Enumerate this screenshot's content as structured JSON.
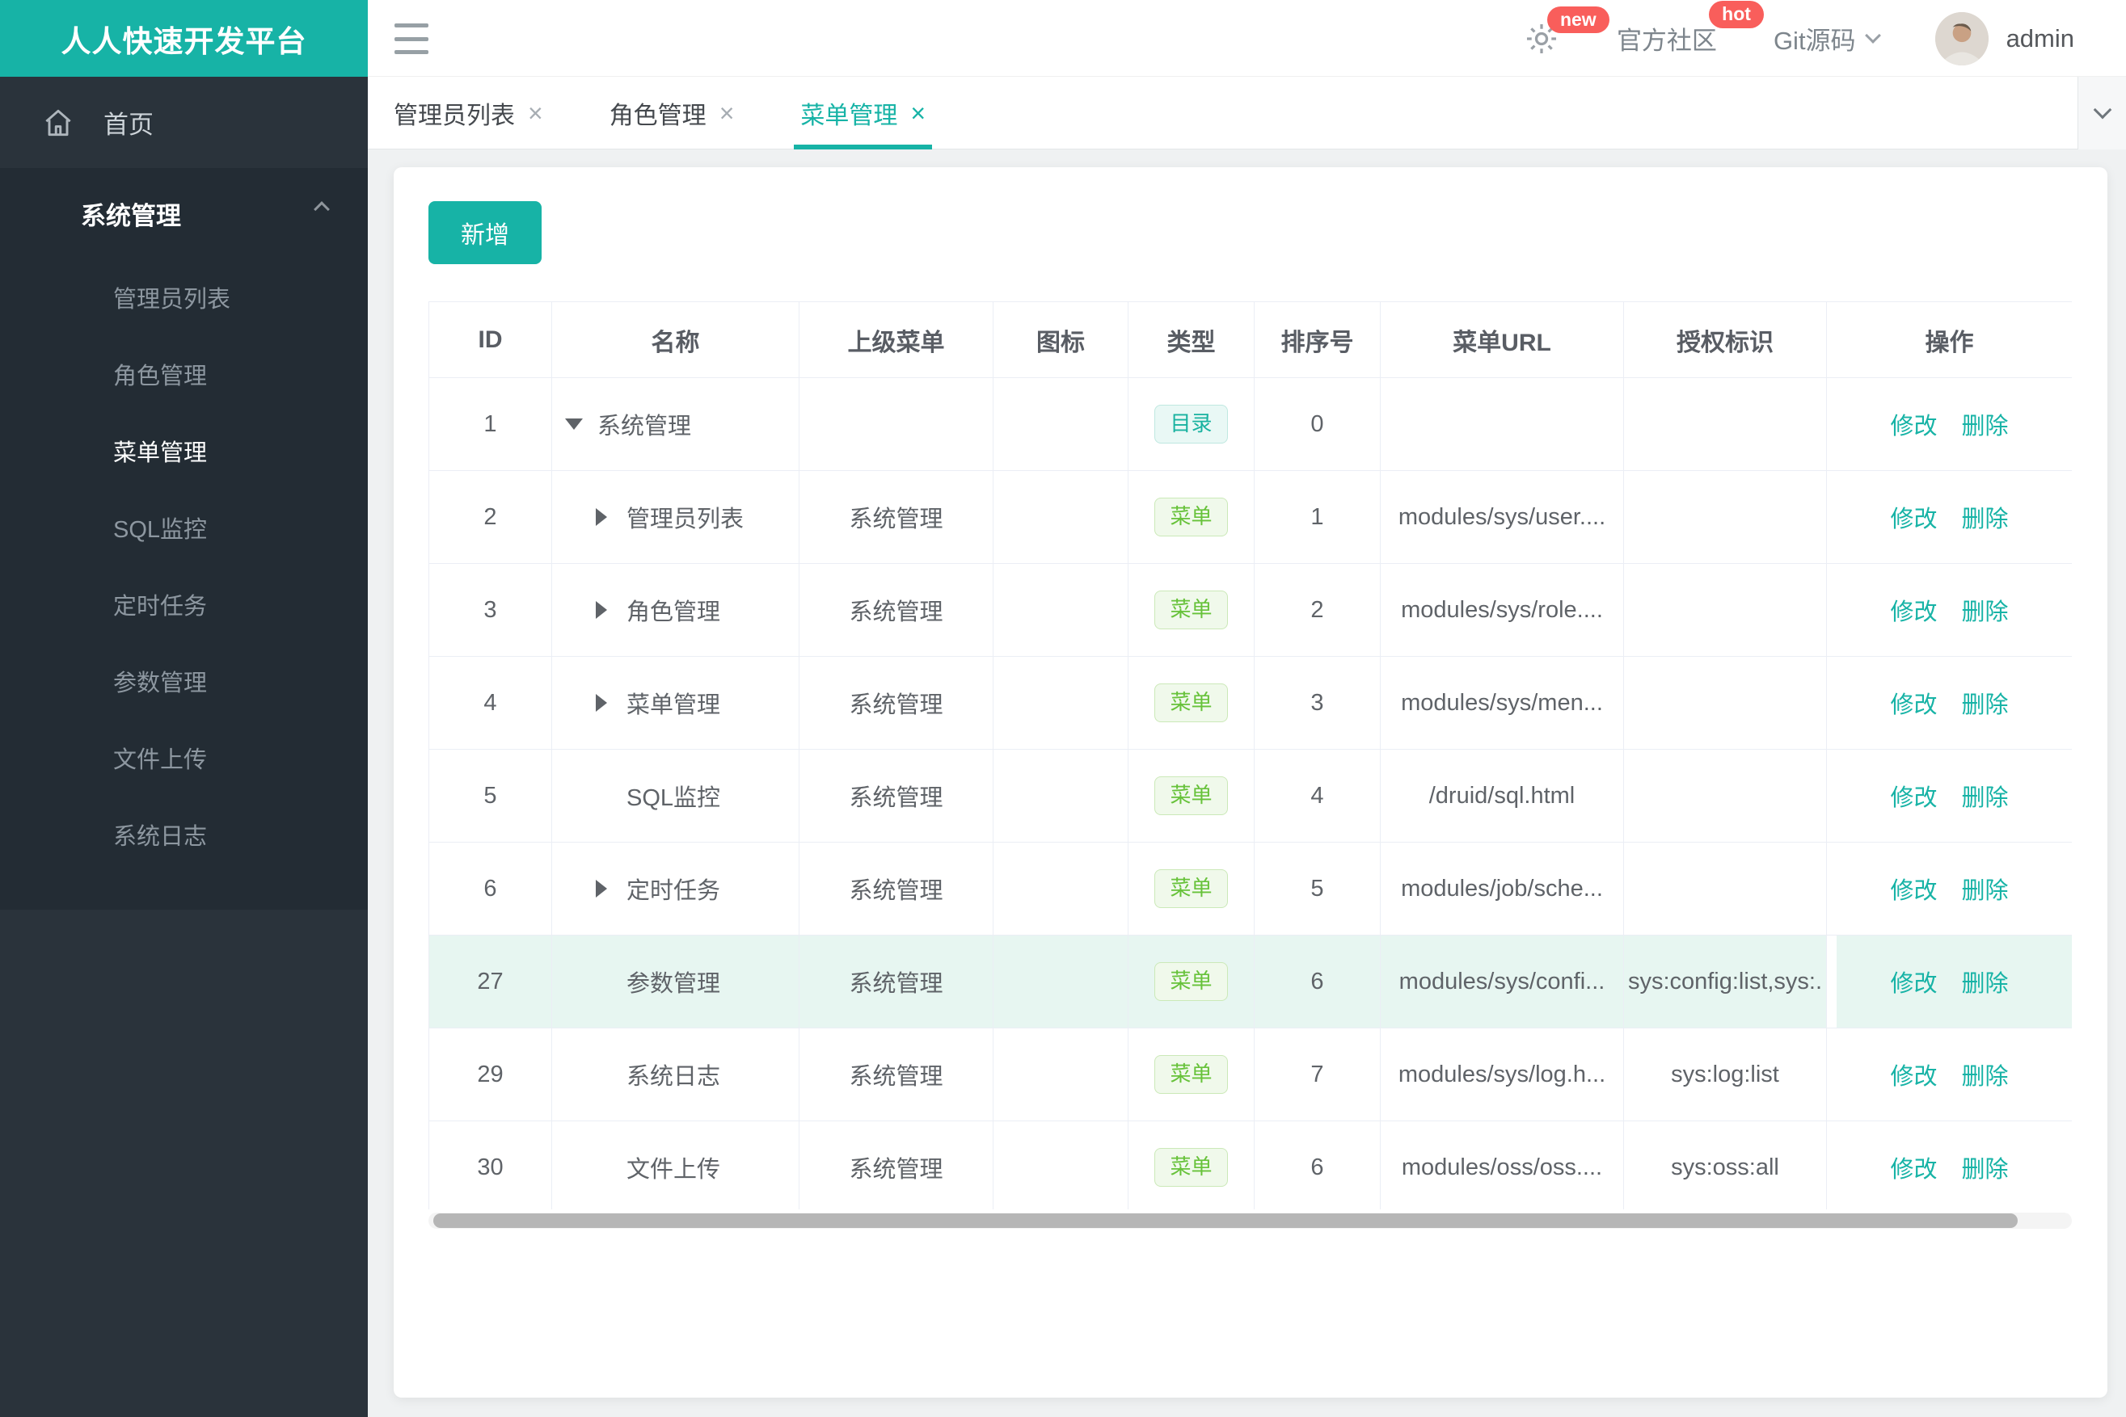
{
  "app": {
    "title": "人人快速开发平台"
  },
  "theme": {
    "accent": "#17b3a6",
    "badge_red": "#f95e5b",
    "sidebar_bg": "#2a333b",
    "sidebar_group_bg": "#232c34",
    "highlight_row_bg": "#e7f6f1",
    "dir_tag_color": "#19b2a0",
    "menu_tag_color": "#67c23a"
  },
  "header": {
    "gear_badge": "new",
    "community_label": "官方社区",
    "community_badge": "hot",
    "git_label": "Git源码",
    "user": "admin"
  },
  "sidebar": {
    "home_label": "首页",
    "group": {
      "label": "系统管理",
      "items": [
        {
          "label": "管理员列表",
          "active": false
        },
        {
          "label": "角色管理",
          "active": false
        },
        {
          "label": "菜单管理",
          "active": true
        },
        {
          "label": "SQL监控",
          "active": false
        },
        {
          "label": "定时任务",
          "active": false
        },
        {
          "label": "参数管理",
          "active": false
        },
        {
          "label": "文件上传",
          "active": false
        },
        {
          "label": "系统日志",
          "active": false
        }
      ]
    }
  },
  "tabs": [
    {
      "label": "管理员列表",
      "active": false
    },
    {
      "label": "角色管理",
      "active": false
    },
    {
      "label": "菜单管理",
      "active": true
    }
  ],
  "ui": {
    "close_glyph": "×"
  },
  "toolbar": {
    "add_label": "新增"
  },
  "table": {
    "columns": [
      "ID",
      "名称",
      "上级菜单",
      "图标",
      "类型",
      "排序号",
      "菜单URL",
      "授权标识",
      "操作"
    ],
    "edit_label": "修改",
    "delete_label": "删除",
    "rows": [
      {
        "id": "1",
        "name": "系统管理",
        "expand": "down",
        "indent": 0,
        "parent": "",
        "icon": "",
        "type": "目录",
        "type_kind": "dir",
        "order": "0",
        "url": "",
        "perms": "",
        "highlight": false
      },
      {
        "id": "2",
        "name": "管理员列表",
        "expand": "right",
        "indent": 1,
        "parent": "系统管理",
        "icon": "",
        "type": "菜单",
        "type_kind": "menu",
        "order": "1",
        "url": "modules/sys/user....",
        "perms": "",
        "highlight": false
      },
      {
        "id": "3",
        "name": "角色管理",
        "expand": "right",
        "indent": 1,
        "parent": "系统管理",
        "icon": "",
        "type": "菜单",
        "type_kind": "menu",
        "order": "2",
        "url": "modules/sys/role....",
        "perms": "",
        "highlight": false
      },
      {
        "id": "4",
        "name": "菜单管理",
        "expand": "right",
        "indent": 1,
        "parent": "系统管理",
        "icon": "",
        "type": "菜单",
        "type_kind": "menu",
        "order": "3",
        "url": "modules/sys/men...",
        "perms": "",
        "highlight": false
      },
      {
        "id": "5",
        "name": "SQL监控",
        "expand": "none",
        "indent": 1,
        "parent": "系统管理",
        "icon": "",
        "type": "菜单",
        "type_kind": "menu",
        "order": "4",
        "url": "/druid/sql.html",
        "perms": "",
        "highlight": false
      },
      {
        "id": "6",
        "name": "定时任务",
        "expand": "right",
        "indent": 1,
        "parent": "系统管理",
        "icon": "",
        "type": "菜单",
        "type_kind": "menu",
        "order": "5",
        "url": "modules/job/sche...",
        "perms": "",
        "highlight": false
      },
      {
        "id": "27",
        "name": "参数管理",
        "expand": "none",
        "indent": 1,
        "parent": "系统管理",
        "icon": "",
        "type": "菜单",
        "type_kind": "menu",
        "order": "6",
        "url": "modules/sys/confi...",
        "perms": "sys:config:list,sys:.",
        "highlight": true
      },
      {
        "id": "29",
        "name": "系统日志",
        "expand": "none",
        "indent": 1,
        "parent": "系统管理",
        "icon": "",
        "type": "菜单",
        "type_kind": "menu",
        "order": "7",
        "url": "modules/sys/log.h...",
        "perms": "sys:log:list",
        "highlight": false
      },
      {
        "id": "30",
        "name": "文件上传",
        "expand": "none",
        "indent": 1,
        "parent": "系统管理",
        "icon": "",
        "type": "菜单",
        "type_kind": "menu",
        "order": "6",
        "url": "modules/oss/oss....",
        "perms": "sys:oss:all",
        "highlight": false
      }
    ]
  }
}
